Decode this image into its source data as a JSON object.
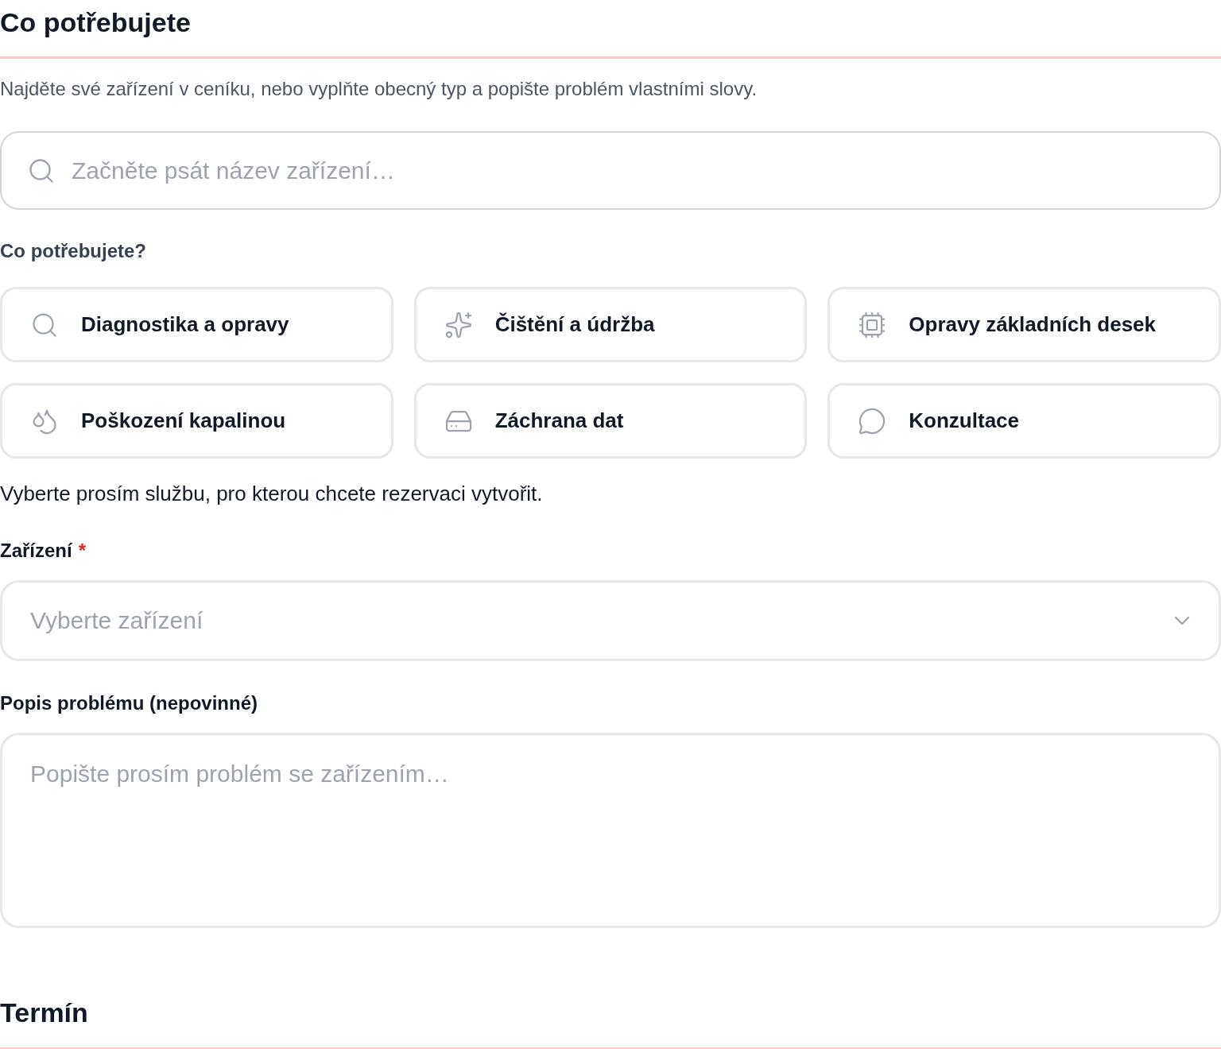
{
  "section": {
    "title": "Co potřebujete"
  },
  "intro": "Najděte své zařízení v ceníku, nebo vyplňte obecný typ a popište problém vlastními slovy.",
  "search": {
    "placeholder": "Začněte psát název zařízení…"
  },
  "service_question": "Co potřebujete?",
  "services": [
    {
      "label": "Diagnostika a opravy",
      "selected": false
    },
    {
      "label": "Čištění a údržba",
      "selected": false
    },
    {
      "label": "Opravy základních desek",
      "selected": false
    },
    {
      "label": "Poškození kapalinou",
      "selected": false
    },
    {
      "label": "Záchrana dat",
      "selected": false
    },
    {
      "label": "Konzultace",
      "selected": false
    }
  ],
  "service_hint": "Vyberte prosím službu, pro kterou chcete rezervaci vytvořit.",
  "device": {
    "label": "Zařízení",
    "required_mark": "*",
    "placeholder": "Vyberte zařízení"
  },
  "description": {
    "label": "Popis problému (nepovinné)",
    "placeholder": "Popište prosím problém se zařízením…"
  },
  "next_section": {
    "title": "Termín"
  }
}
